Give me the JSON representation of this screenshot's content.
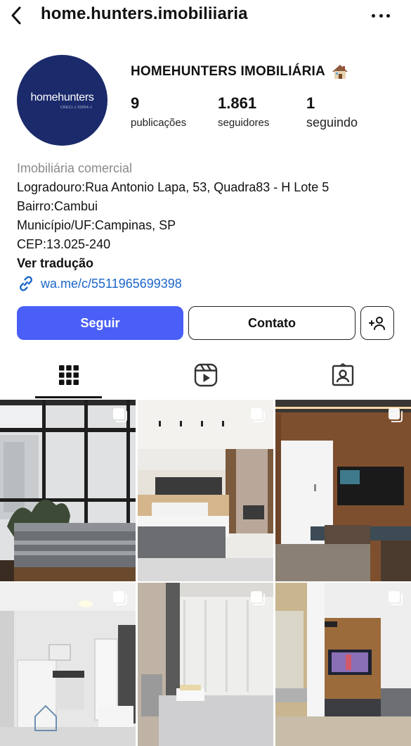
{
  "header": {
    "username": "home.hunters.imobiliiaria"
  },
  "avatar": {
    "brand": "homehunters",
    "sub": "CRECI-J 33054-J"
  },
  "profile": {
    "name": "HOMEHUNTERS IMOBILIÁRIA",
    "stats": [
      {
        "value": "9",
        "label": "publicações"
      },
      {
        "value": "1.861",
        "label": "seguidores"
      },
      {
        "value": "1",
        "label": "seguindo"
      }
    ]
  },
  "bio": {
    "category": "Imobiliária comercial",
    "lines": [
      "Logradouro:Rua Antonio Lapa, 53, Quadra83 - H Lote 5",
      "Bairro:Cambui",
      "Município/UF:Campinas, SP",
      "CEP:13.025-240"
    ],
    "translate": "Ver tradução",
    "link": "wa.me/c/5511965699398"
  },
  "actions": {
    "follow": "Seguir",
    "contact": "Contato"
  },
  "colors": {
    "follow_button": "#4a5ff7",
    "link": "#1a66c9",
    "avatar_bg": "#1b2a6b"
  },
  "tabs": [
    "grid-icon",
    "reels-icon",
    "tagged-icon"
  ]
}
